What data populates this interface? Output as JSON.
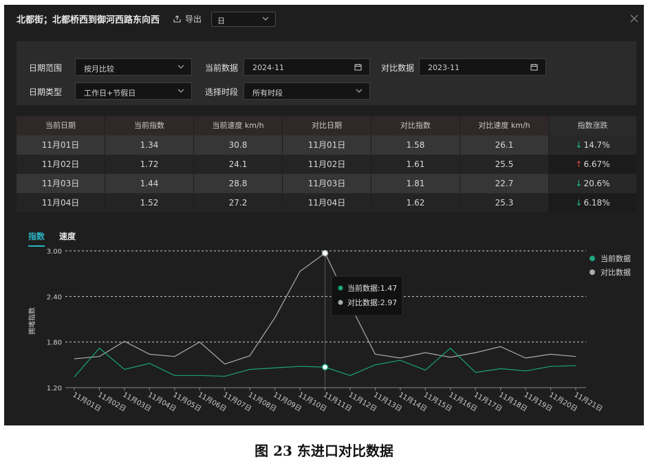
{
  "header": {
    "title": "北都街；北都桥西到御河西路东向西",
    "export_label": "导出",
    "granularity": "日"
  },
  "filters": {
    "date_range_label": "日期范围",
    "date_range_value": "按月比较",
    "current_label": "当前数据",
    "current_value": "2024-11",
    "compare_label": "对比数据",
    "compare_value": "2023-11",
    "date_type_label": "日期类型",
    "date_type_value": "工作日+节假日",
    "period_label": "选择时段",
    "period_value": "所有时段"
  },
  "table": {
    "columns": [
      "当前日期",
      "当前指数",
      "当前速度 km/h",
      "对比日期",
      "对比指数",
      "对比速度 km/h",
      "指数涨跌"
    ],
    "rows": [
      {
        "cells": [
          "11月01日",
          "1.34",
          "30.8",
          "11月01日",
          "1.58",
          "26.1"
        ],
        "change": "14.7%",
        "dir": "down"
      },
      {
        "cells": [
          "11月02日",
          "1.72",
          "24.1",
          "11月02日",
          "1.61",
          "25.5"
        ],
        "change": "6.67%",
        "dir": "up"
      },
      {
        "cells": [
          "11月03日",
          "1.44",
          "28.8",
          "11月03日",
          "1.81",
          "22.7"
        ],
        "change": "20.6%",
        "dir": "down"
      },
      {
        "cells": [
          "11月04日",
          "1.52",
          "27.2",
          "11月04日",
          "1.62",
          "25.3"
        ],
        "change": "6.18%",
        "dir": "down"
      }
    ],
    "up_color": "#e14b4b",
    "down_color": "#25c08a"
  },
  "tabs": {
    "index": "指数",
    "speed": "速度"
  },
  "chart_data": {
    "type": "line",
    "ylabel": "拥堵指数",
    "ylim": [
      1.2,
      3.0
    ],
    "yticks": [
      "1.20",
      "1.80",
      "2.40",
      "3.00"
    ],
    "categories": [
      "11月01日",
      "11月02日",
      "11月03日",
      "11月04日",
      "11月05日",
      "11月06日",
      "11月07日",
      "11月08日",
      "11月09日",
      "11月10日",
      "11月11日",
      "11月12日",
      "11月13日",
      "11月14日",
      "11月15日",
      "11月16日",
      "11月17日",
      "11月18日",
      "11月19日",
      "11月20日",
      "11月21日"
    ],
    "series": [
      {
        "name": "当前数据",
        "color": "#1aa57f",
        "values": [
          1.34,
          1.72,
          1.44,
          1.52,
          1.36,
          1.36,
          1.35,
          1.44,
          1.46,
          1.48,
          1.47,
          1.36,
          1.5,
          1.56,
          1.43,
          1.72,
          1.4,
          1.45,
          1.42,
          1.48,
          1.49
        ]
      },
      {
        "name": "对比数据",
        "color": "#a8aeb0",
        "values": [
          1.58,
          1.61,
          1.81,
          1.64,
          1.61,
          1.8,
          1.51,
          1.62,
          2.12,
          2.73,
          2.97,
          2.29,
          1.64,
          1.59,
          1.66,
          1.6,
          1.66,
          1.74,
          1.59,
          1.64,
          1.61
        ]
      }
    ],
    "tooltip": {
      "index": 10,
      "current_label": "当前数据:1.47",
      "compare_label": "对比数据:2.97"
    }
  },
  "caption": "图 23 东进口对比数据"
}
